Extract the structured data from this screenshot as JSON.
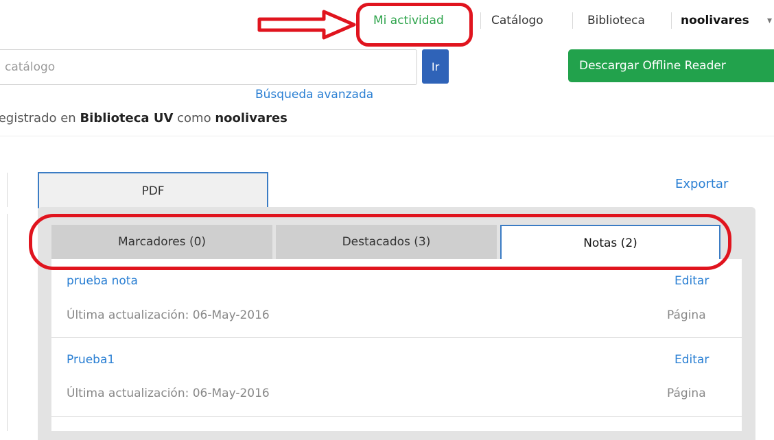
{
  "nav": {
    "activity": "Mi actividad",
    "catalog": "Catálogo",
    "library": "Biblioteca",
    "user": "noolivares"
  },
  "search": {
    "placeholder": "catálogo",
    "go_label": "Ir",
    "advanced_label": "Búsqueda avanzada"
  },
  "offline_reader_label": "Descargar Offline Reader",
  "register": {
    "prefix": "Registrado en",
    "library": "Biblioteca UV",
    "middle": "como",
    "user": "noolivares"
  },
  "tabs": {
    "pdf": "PDF",
    "export": "Exportar"
  },
  "subtabs": {
    "bookmarks": "Marcadores (0)",
    "highlights": "Destacados (3)",
    "notes": "Notas (2)"
  },
  "notes": [
    {
      "title": "prueba nota",
      "edit": "Editar",
      "updated": "Última actualización: 06-May-2016",
      "page": "Página"
    },
    {
      "title": "Prueba1",
      "edit": "Editar",
      "updated": "Última actualización: 06-May-2016",
      "page": "Página"
    }
  ],
  "colors": {
    "accent_green": "#22a24c",
    "link_blue": "#2a7fd3",
    "go_button_blue": "#2f63b8",
    "annotation_red": "#e0141e"
  }
}
